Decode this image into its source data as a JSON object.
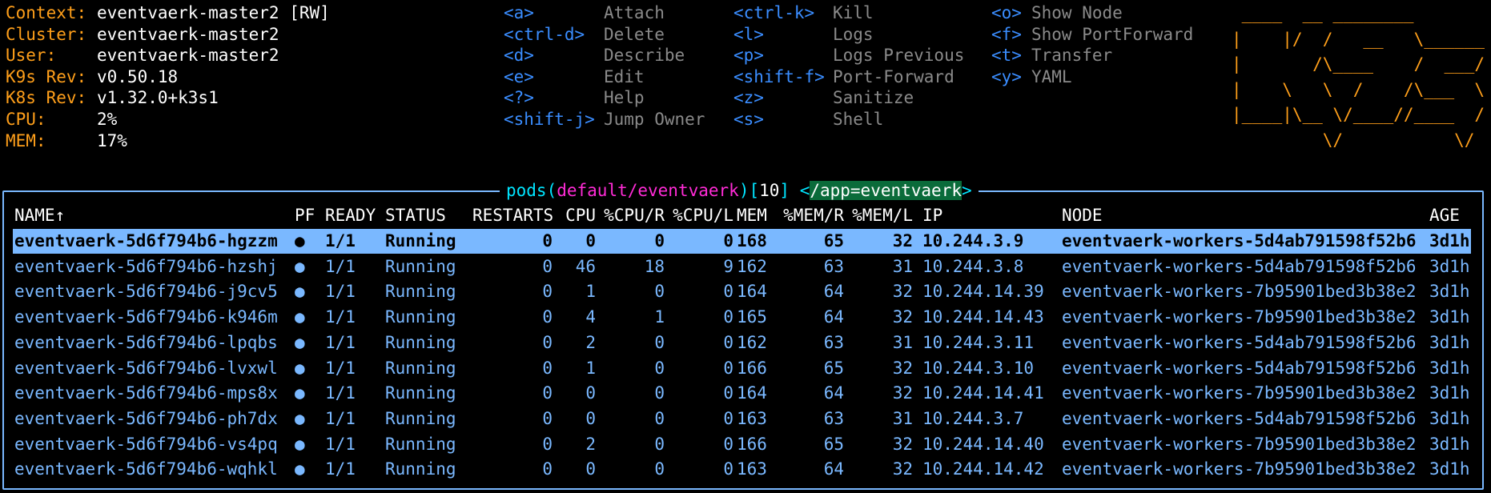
{
  "context_info": [
    {
      "label": "Context:",
      "value": "eventvaerk-master2 [RW]"
    },
    {
      "label": "Cluster:",
      "value": "eventvaerk-master2"
    },
    {
      "label": "User:",
      "value": "eventvaerk-master2"
    },
    {
      "label": "K9s Rev:",
      "value": "v0.50.18"
    },
    {
      "label": "K8s Rev:",
      "value": "v1.32.0+k3s1"
    },
    {
      "label": "CPU:",
      "value": "2%"
    },
    {
      "label": "MEM:",
      "value": "17%"
    }
  ],
  "hotkeys": [
    [
      {
        "key": "<a>",
        "action": "Attach"
      },
      {
        "key": "<ctrl-d>",
        "action": "Delete"
      },
      {
        "key": "<d>",
        "action": "Describe"
      },
      {
        "key": "<e>",
        "action": "Edit"
      },
      {
        "key": "<?>",
        "action": "Help"
      },
      {
        "key": "<shift-j>",
        "action": "Jump Owner"
      }
    ],
    [
      {
        "key": "<ctrl-k>",
        "action": "Kill"
      },
      {
        "key": "<l>",
        "action": "Logs"
      },
      {
        "key": "<p>",
        "action": "Logs Previous"
      },
      {
        "key": "<shift-f>",
        "action": "Port-Forward"
      },
      {
        "key": "<z>",
        "action": "Sanitize"
      },
      {
        "key": "<s>",
        "action": "Shell"
      }
    ],
    [
      {
        "key": "<o>",
        "action": "Show Node"
      },
      {
        "key": "<f>",
        "action": "Show PortForward"
      },
      {
        "key": "<t>",
        "action": "Transfer"
      },
      {
        "key": "<y>",
        "action": "YAML"
      }
    ]
  ],
  "logo": {
    "lines": [
      " ____  __ ________        ",
      "|    |/  /   __   \\______ ",
      "|       /\\____    /  ___/ ",
      "|    \\   \\  /    /\\___  \\ ",
      "|____|\\__ \\/____//____  / ",
      "         \\/           \\/  "
    ]
  },
  "view": {
    "resource": "pods",
    "namespace": "default/eventvaerk",
    "count": "10",
    "filter": "/app=eventvaerk"
  },
  "table": {
    "headers": [
      "NAME↑",
      "PF",
      "READY",
      "STATUS",
      "RESTARTS",
      "CPU",
      "%CPU/R",
      "%CPU/L",
      "MEM",
      "%MEM/R",
      "%MEM/L",
      "IP",
      "NODE",
      "AGE"
    ],
    "rows": [
      [
        "eventvaerk-5d6f794b6-hgzzm",
        "●",
        "1/1",
        "Running",
        "0",
        "0",
        "0",
        "0",
        "168",
        "65",
        "32",
        "10.244.3.9",
        "eventvaerk-workers-5d4ab791598f52b6",
        "3d1h"
      ],
      [
        "eventvaerk-5d6f794b6-hzshj",
        "●",
        "1/1",
        "Running",
        "0",
        "46",
        "18",
        "9",
        "162",
        "63",
        "31",
        "10.244.3.8",
        "eventvaerk-workers-5d4ab791598f52b6",
        "3d1h"
      ],
      [
        "eventvaerk-5d6f794b6-j9cv5",
        "●",
        "1/1",
        "Running",
        "0",
        "1",
        "0",
        "0",
        "164",
        "64",
        "32",
        "10.244.14.39",
        "eventvaerk-workers-7b95901bed3b38e2",
        "3d1h"
      ],
      [
        "eventvaerk-5d6f794b6-k946m",
        "●",
        "1/1",
        "Running",
        "0",
        "4",
        "1",
        "0",
        "165",
        "64",
        "32",
        "10.244.14.43",
        "eventvaerk-workers-7b95901bed3b38e2",
        "3d1h"
      ],
      [
        "eventvaerk-5d6f794b6-lpqbs",
        "●",
        "1/1",
        "Running",
        "0",
        "2",
        "0",
        "0",
        "162",
        "63",
        "31",
        "10.244.3.11",
        "eventvaerk-workers-5d4ab791598f52b6",
        "3d1h"
      ],
      [
        "eventvaerk-5d6f794b6-lvxwl",
        "●",
        "1/1",
        "Running",
        "0",
        "1",
        "0",
        "0",
        "166",
        "65",
        "32",
        "10.244.3.10",
        "eventvaerk-workers-5d4ab791598f52b6",
        "3d1h"
      ],
      [
        "eventvaerk-5d6f794b6-mps8x",
        "●",
        "1/1",
        "Running",
        "0",
        "0",
        "0",
        "0",
        "164",
        "64",
        "32",
        "10.244.14.41",
        "eventvaerk-workers-7b95901bed3b38e2",
        "3d1h"
      ],
      [
        "eventvaerk-5d6f794b6-ph7dx",
        "●",
        "1/1",
        "Running",
        "0",
        "0",
        "0",
        "0",
        "163",
        "63",
        "31",
        "10.244.3.7",
        "eventvaerk-workers-5d4ab791598f52b6",
        "3d1h"
      ],
      [
        "eventvaerk-5d6f794b6-vs4pq",
        "●",
        "1/1",
        "Running",
        "0",
        "2",
        "0",
        "0",
        "166",
        "65",
        "32",
        "10.244.14.40",
        "eventvaerk-workers-7b95901bed3b38e2",
        "3d1h"
      ],
      [
        "eventvaerk-5d6f794b6-wqhkl",
        "●",
        "1/1",
        "Running",
        "0",
        "0",
        "0",
        "0",
        "163",
        "64",
        "32",
        "10.244.14.42",
        "eventvaerk-workers-7b95901bed3b38e2",
        "3d1h"
      ]
    ],
    "selected_row": 0
  },
  "colors": {
    "label": "#ff9f1a",
    "hotkey": "#3a8dff",
    "row_text": "#7ab8ff",
    "selected_bg": "#7ab8ff",
    "resource": "#00e5ff",
    "namespace": "#ff2bd6",
    "filter_bg": "#0a6b3a"
  }
}
